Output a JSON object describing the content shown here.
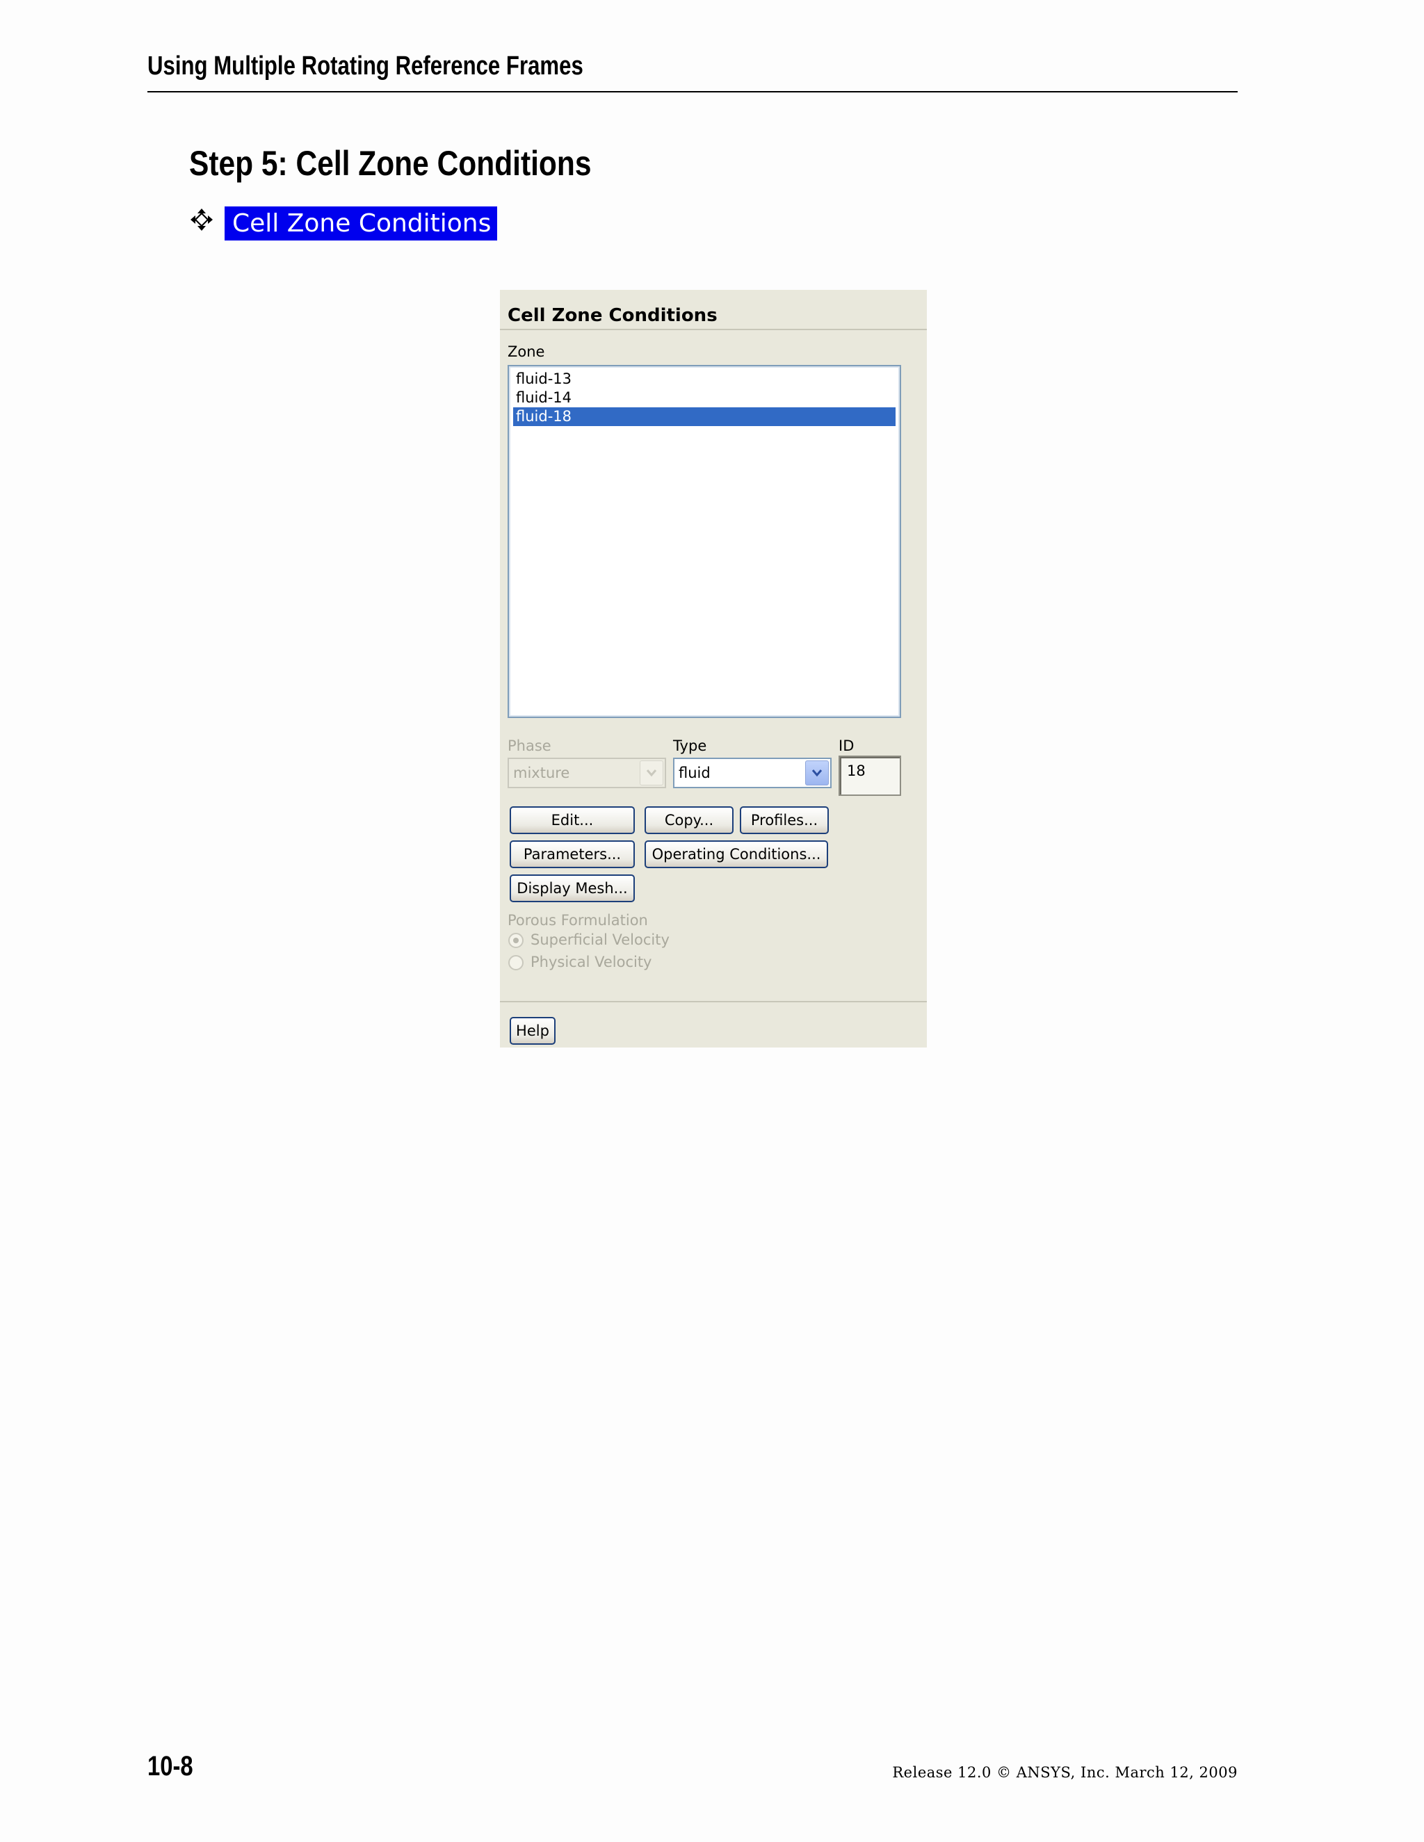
{
  "page": {
    "running_header": "Using Multiple Rotating Reference Frames",
    "step_heading": "Step 5: Cell Zone Conditions",
    "nav_label": "Cell Zone Conditions",
    "page_number": "10-8",
    "release_line": "Release 12.0 © ANSYS, Inc. March 12, 2009"
  },
  "panel": {
    "title": "Cell Zone Conditions",
    "zone_label": "Zone",
    "zones": [
      "fluid-13",
      "fluid-14",
      "fluid-18"
    ],
    "selected_zone": "fluid-18",
    "phase_label": "Phase",
    "phase_value": "mixture",
    "type_label": "Type",
    "type_value": "fluid",
    "id_label": "ID",
    "id_value": "18",
    "buttons": {
      "edit": "Edit...",
      "copy": "Copy...",
      "profiles": "Profiles...",
      "parameters": "Parameters...",
      "operating_conditions": "Operating Conditions...",
      "display_mesh": "Display Mesh...",
      "help": "Help"
    },
    "porous_label": "Porous Formulation",
    "porous_options": [
      "Superficial Velocity",
      "Physical Velocity"
    ],
    "porous_selected": "Superficial Velocity"
  },
  "colors": {
    "nav_chip": "#0000ee",
    "selection": "#316ac5",
    "panel_bg": "#e9e8dc"
  }
}
